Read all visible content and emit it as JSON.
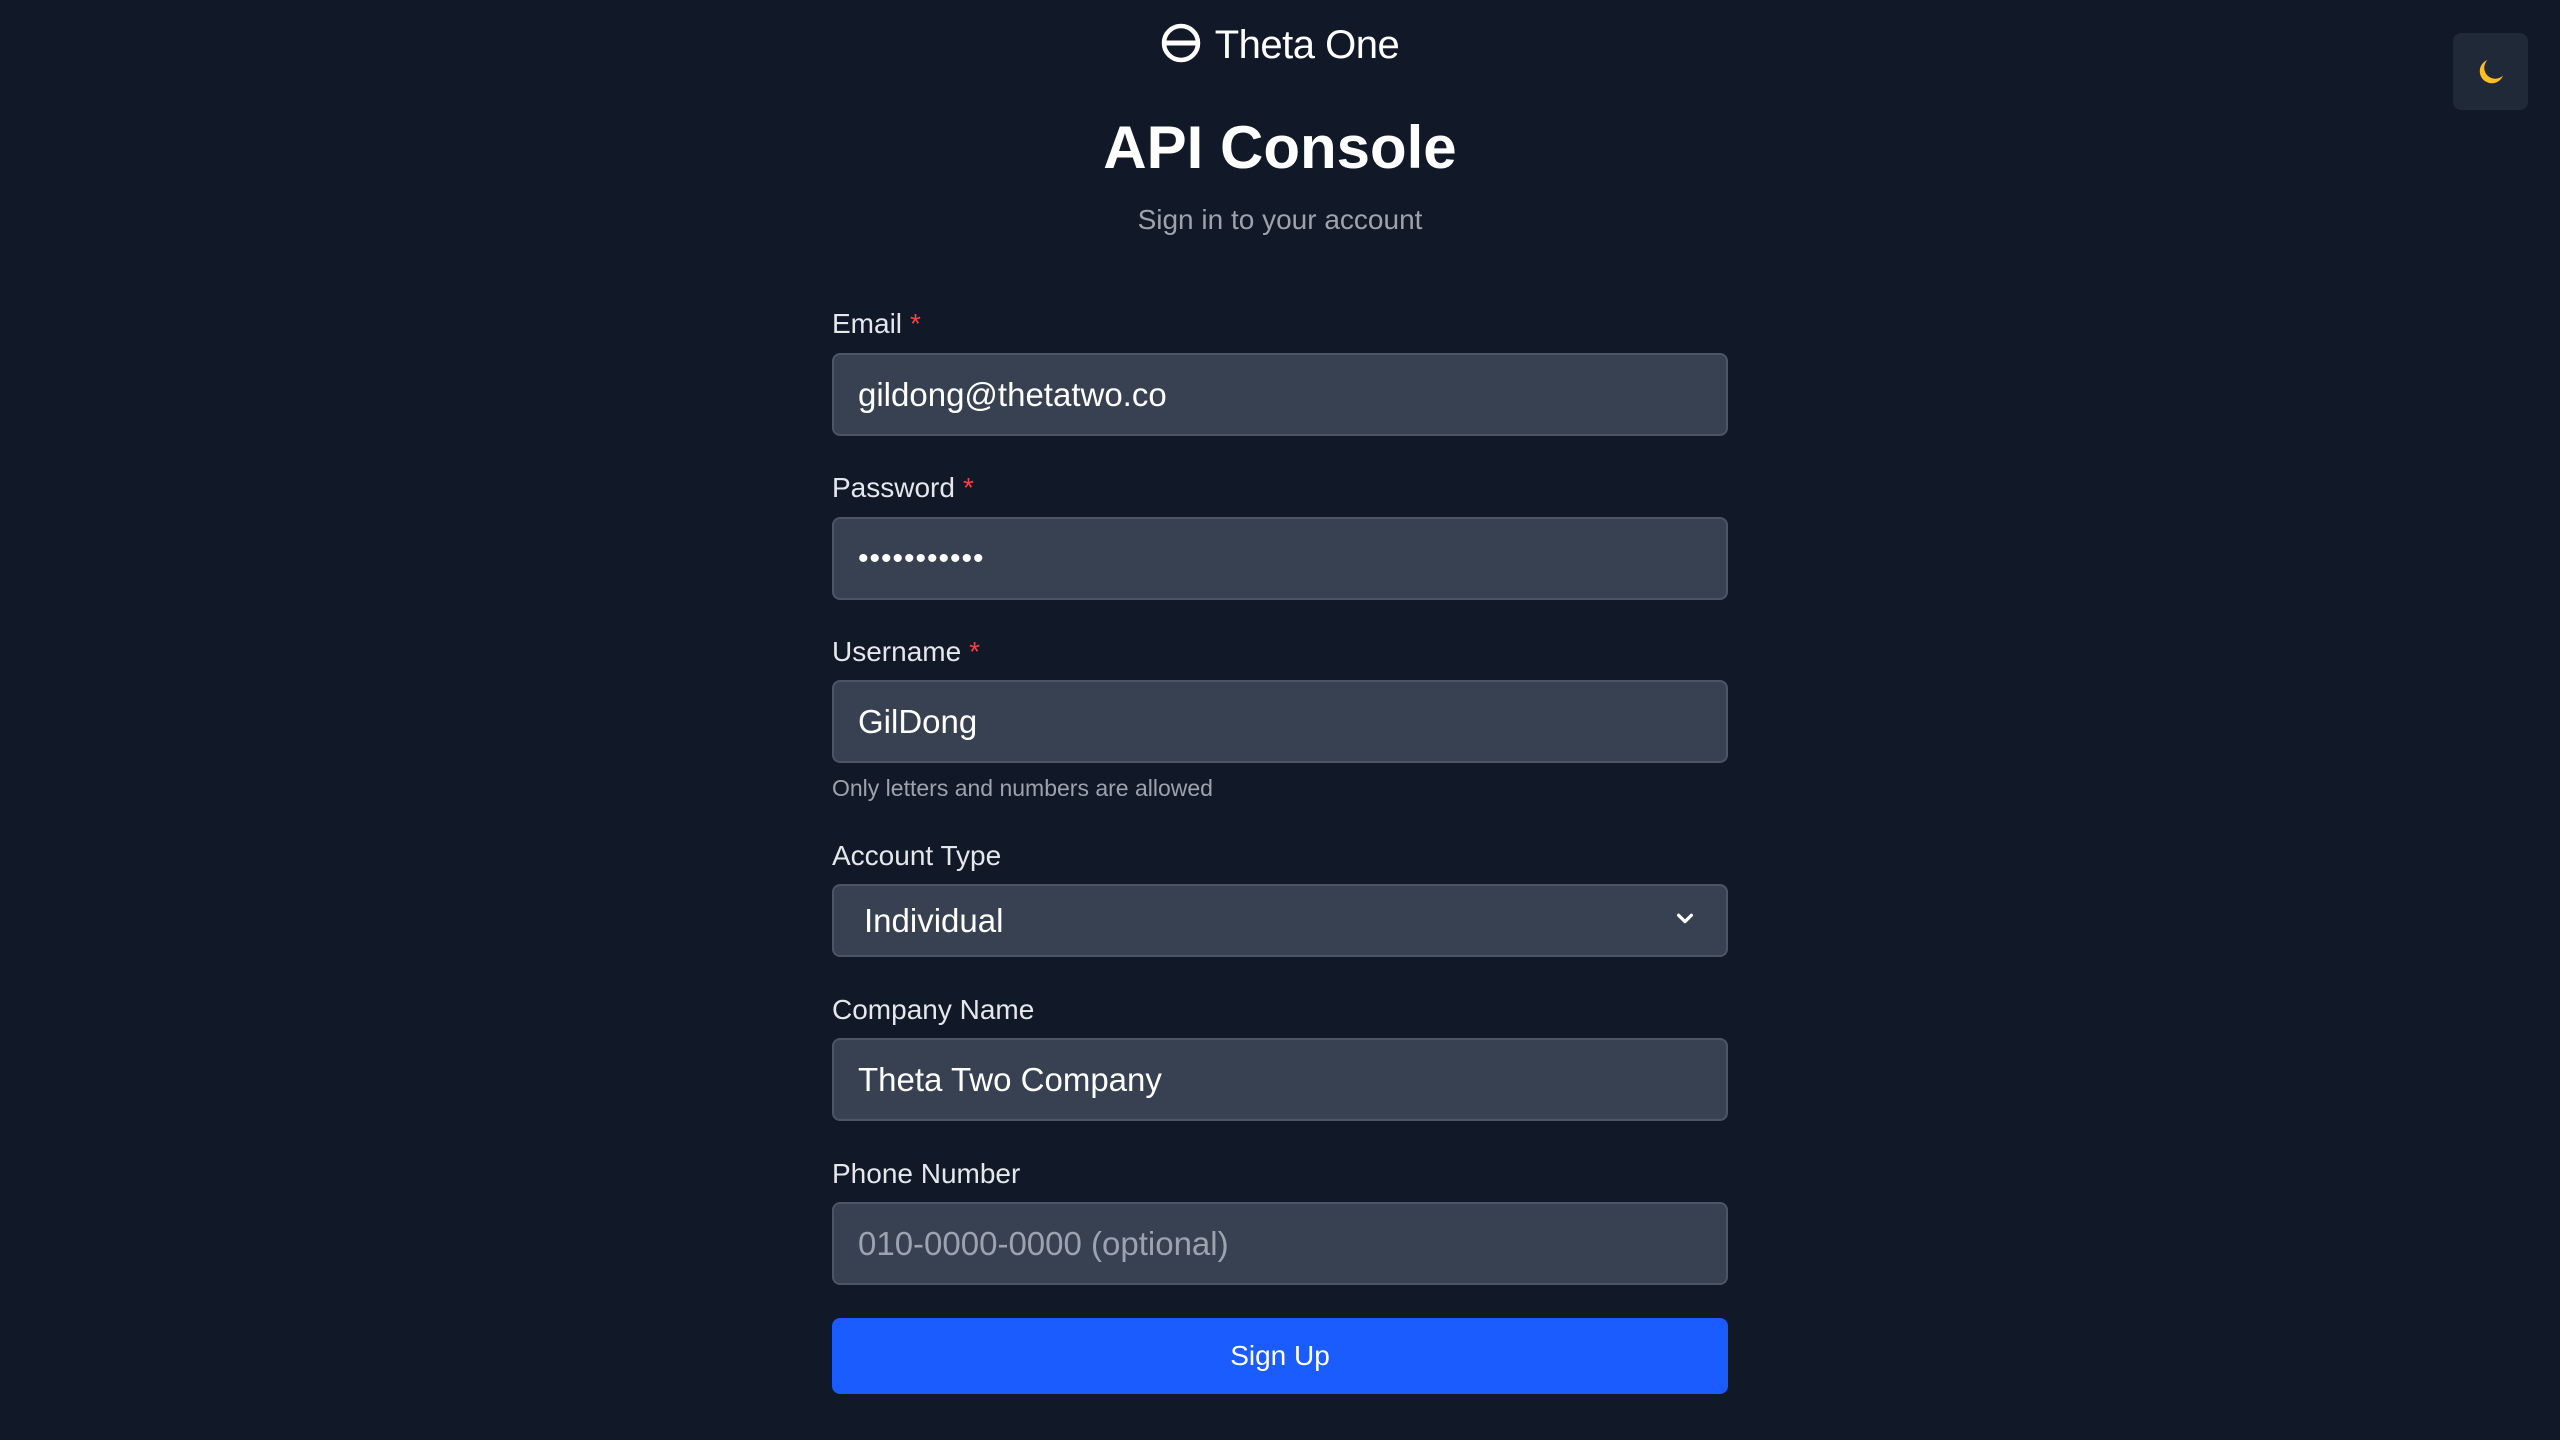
{
  "brand": {
    "name": "Theta One",
    "logo_icon": "theta-logo-icon"
  },
  "theme_toggle": {
    "icon": "moon-icon",
    "color": "#fbbf24"
  },
  "header": {
    "title": "API Console",
    "subtitle": "Sign in to your account"
  },
  "form": {
    "email": {
      "label": "Email",
      "required_mark": "*",
      "value": "gildong@thetatwo.co"
    },
    "password": {
      "label": "Password",
      "required_mark": "*",
      "value": "•••••••••••"
    },
    "username": {
      "label": "Username",
      "required_mark": "*",
      "value": "GilDong",
      "hint": "Only letters and numbers are allowed"
    },
    "account_type": {
      "label": "Account Type",
      "selected": "Individual"
    },
    "company_name": {
      "label": "Company Name",
      "value": "Theta Two Company"
    },
    "phone_number": {
      "label": "Phone Number",
      "value": "",
      "placeholder": "010-0000-0000 (optional)"
    },
    "submit_label": "Sign Up"
  },
  "colors": {
    "background": "#111827",
    "input_background": "#374151",
    "primary": "#1a5cff",
    "required": "#ef4444"
  }
}
